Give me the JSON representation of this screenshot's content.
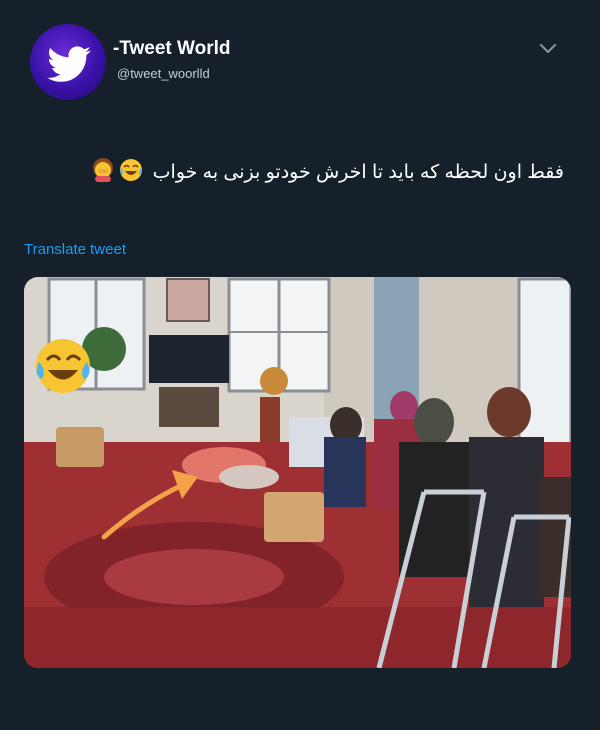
{
  "tweet": {
    "display_name": "-Tweet World",
    "handle": "@tweet_woorlld",
    "text": "فقط اون لحظه که باید تا اخرش خودتو بزنی به خواب",
    "translate_label": "Translate tweet",
    "icons": {
      "avatar": "twitter-bird-icon",
      "menu": "chevron-down-icon",
      "emoji_1": "face-with-tears-of-joy",
      "emoji_2": "woman-facepalming",
      "overlay_emoji": "face-with-tears-of-joy",
      "overlay_arrow": "curved-arrow"
    },
    "colors": {
      "background": "#15202b",
      "link": "#1d9bf0",
      "arrow": "#f4a24a"
    }
  }
}
